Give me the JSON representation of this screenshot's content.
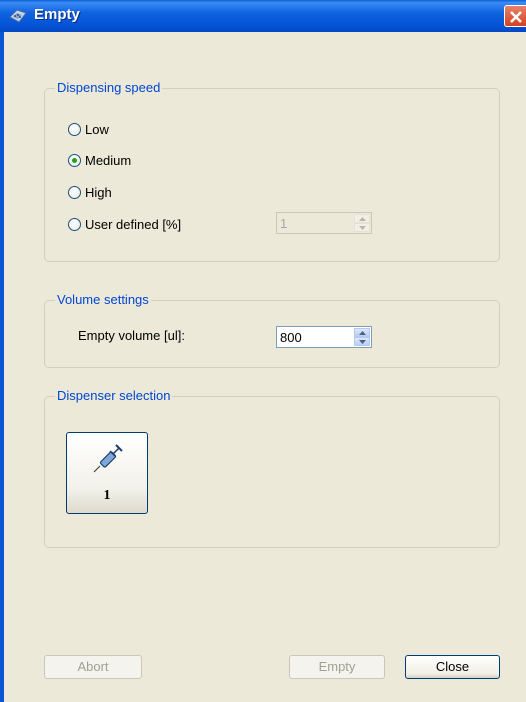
{
  "window": {
    "title": "Empty",
    "icon": "app-icon"
  },
  "dispensing_speed": {
    "legend": "Dispensing speed",
    "options": [
      {
        "label": "Low",
        "checked": false
      },
      {
        "label": "Medium",
        "checked": true
      },
      {
        "label": "High",
        "checked": false
      },
      {
        "label": "User defined [%]",
        "checked": false
      }
    ],
    "user_defined_value": "1"
  },
  "volume_settings": {
    "legend": "Volume settings",
    "label": "Empty volume [ul]:",
    "value": "800"
  },
  "dispenser_selection": {
    "legend": "Dispenser selection",
    "dispenser_number": "1",
    "icon": "syringe-icon"
  },
  "buttons": {
    "abort": "Abort",
    "empty": "Empty",
    "close": "Close"
  }
}
